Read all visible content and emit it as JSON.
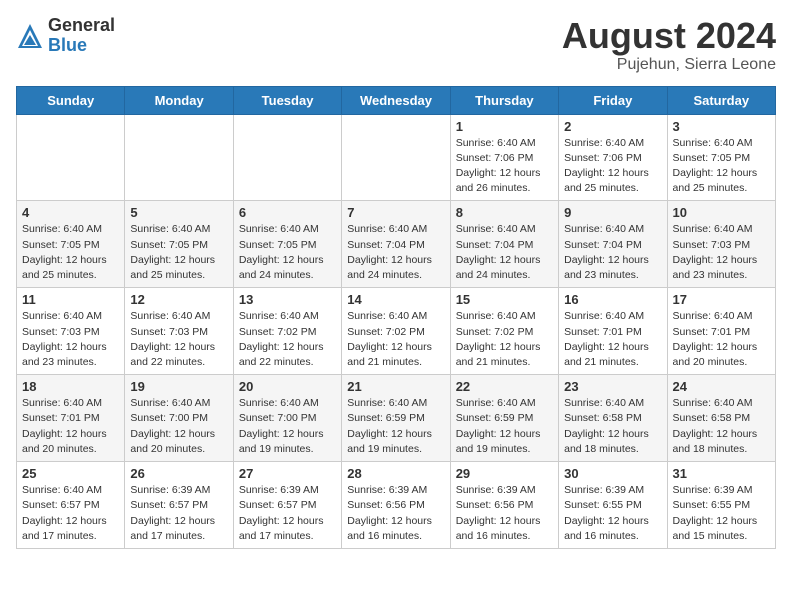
{
  "logo": {
    "general": "General",
    "blue": "Blue"
  },
  "title": "August 2024",
  "subtitle": "Pujehun, Sierra Leone",
  "days_of_week": [
    "Sunday",
    "Monday",
    "Tuesday",
    "Wednesday",
    "Thursday",
    "Friday",
    "Saturday"
  ],
  "weeks": [
    [
      {
        "day": "",
        "detail": ""
      },
      {
        "day": "",
        "detail": ""
      },
      {
        "day": "",
        "detail": ""
      },
      {
        "day": "",
        "detail": ""
      },
      {
        "day": "1",
        "detail": "Sunrise: 6:40 AM\nSunset: 7:06 PM\nDaylight: 12 hours\nand 26 minutes."
      },
      {
        "day": "2",
        "detail": "Sunrise: 6:40 AM\nSunset: 7:06 PM\nDaylight: 12 hours\nand 25 minutes."
      },
      {
        "day": "3",
        "detail": "Sunrise: 6:40 AM\nSunset: 7:05 PM\nDaylight: 12 hours\nand 25 minutes."
      }
    ],
    [
      {
        "day": "4",
        "detail": "Sunrise: 6:40 AM\nSunset: 7:05 PM\nDaylight: 12 hours\nand 25 minutes."
      },
      {
        "day": "5",
        "detail": "Sunrise: 6:40 AM\nSunset: 7:05 PM\nDaylight: 12 hours\nand 25 minutes."
      },
      {
        "day": "6",
        "detail": "Sunrise: 6:40 AM\nSunset: 7:05 PM\nDaylight: 12 hours\nand 24 minutes."
      },
      {
        "day": "7",
        "detail": "Sunrise: 6:40 AM\nSunset: 7:04 PM\nDaylight: 12 hours\nand 24 minutes."
      },
      {
        "day": "8",
        "detail": "Sunrise: 6:40 AM\nSunset: 7:04 PM\nDaylight: 12 hours\nand 24 minutes."
      },
      {
        "day": "9",
        "detail": "Sunrise: 6:40 AM\nSunset: 7:04 PM\nDaylight: 12 hours\nand 23 minutes."
      },
      {
        "day": "10",
        "detail": "Sunrise: 6:40 AM\nSunset: 7:03 PM\nDaylight: 12 hours\nand 23 minutes."
      }
    ],
    [
      {
        "day": "11",
        "detail": "Sunrise: 6:40 AM\nSunset: 7:03 PM\nDaylight: 12 hours\nand 23 minutes."
      },
      {
        "day": "12",
        "detail": "Sunrise: 6:40 AM\nSunset: 7:03 PM\nDaylight: 12 hours\nand 22 minutes."
      },
      {
        "day": "13",
        "detail": "Sunrise: 6:40 AM\nSunset: 7:02 PM\nDaylight: 12 hours\nand 22 minutes."
      },
      {
        "day": "14",
        "detail": "Sunrise: 6:40 AM\nSunset: 7:02 PM\nDaylight: 12 hours\nand 21 minutes."
      },
      {
        "day": "15",
        "detail": "Sunrise: 6:40 AM\nSunset: 7:02 PM\nDaylight: 12 hours\nand 21 minutes."
      },
      {
        "day": "16",
        "detail": "Sunrise: 6:40 AM\nSunset: 7:01 PM\nDaylight: 12 hours\nand 21 minutes."
      },
      {
        "day": "17",
        "detail": "Sunrise: 6:40 AM\nSunset: 7:01 PM\nDaylight: 12 hours\nand 20 minutes."
      }
    ],
    [
      {
        "day": "18",
        "detail": "Sunrise: 6:40 AM\nSunset: 7:01 PM\nDaylight: 12 hours\nand 20 minutes."
      },
      {
        "day": "19",
        "detail": "Sunrise: 6:40 AM\nSunset: 7:00 PM\nDaylight: 12 hours\nand 20 minutes."
      },
      {
        "day": "20",
        "detail": "Sunrise: 6:40 AM\nSunset: 7:00 PM\nDaylight: 12 hours\nand 19 minutes."
      },
      {
        "day": "21",
        "detail": "Sunrise: 6:40 AM\nSunset: 6:59 PM\nDaylight: 12 hours\nand 19 minutes."
      },
      {
        "day": "22",
        "detail": "Sunrise: 6:40 AM\nSunset: 6:59 PM\nDaylight: 12 hours\nand 19 minutes."
      },
      {
        "day": "23",
        "detail": "Sunrise: 6:40 AM\nSunset: 6:58 PM\nDaylight: 12 hours\nand 18 minutes."
      },
      {
        "day": "24",
        "detail": "Sunrise: 6:40 AM\nSunset: 6:58 PM\nDaylight: 12 hours\nand 18 minutes."
      }
    ],
    [
      {
        "day": "25",
        "detail": "Sunrise: 6:40 AM\nSunset: 6:57 PM\nDaylight: 12 hours\nand 17 minutes."
      },
      {
        "day": "26",
        "detail": "Sunrise: 6:39 AM\nSunset: 6:57 PM\nDaylight: 12 hours\nand 17 minutes."
      },
      {
        "day": "27",
        "detail": "Sunrise: 6:39 AM\nSunset: 6:57 PM\nDaylight: 12 hours\nand 17 minutes."
      },
      {
        "day": "28",
        "detail": "Sunrise: 6:39 AM\nSunset: 6:56 PM\nDaylight: 12 hours\nand 16 minutes."
      },
      {
        "day": "29",
        "detail": "Sunrise: 6:39 AM\nSunset: 6:56 PM\nDaylight: 12 hours\nand 16 minutes."
      },
      {
        "day": "30",
        "detail": "Sunrise: 6:39 AM\nSunset: 6:55 PM\nDaylight: 12 hours\nand 16 minutes."
      },
      {
        "day": "31",
        "detail": "Sunrise: 6:39 AM\nSunset: 6:55 PM\nDaylight: 12 hours\nand 15 minutes."
      }
    ]
  ]
}
